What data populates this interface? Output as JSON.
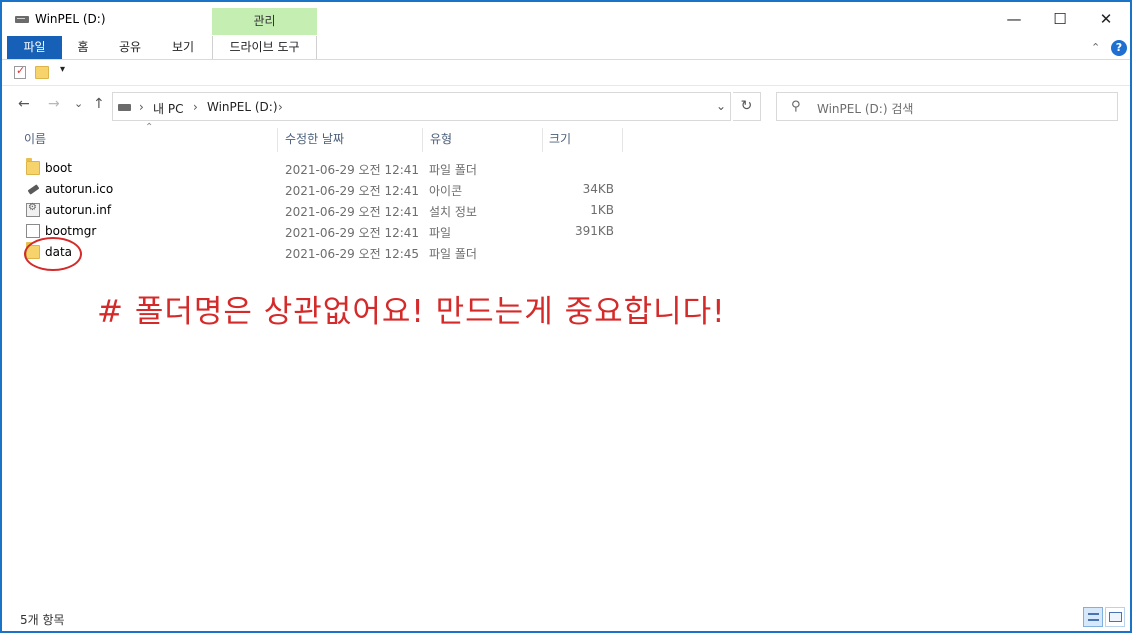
{
  "window": {
    "title": "WinPEL (D:)",
    "context_tab": "관리",
    "controls": {
      "minimize": "—",
      "maximize": "☐",
      "close": "✕"
    }
  },
  "ribbon": {
    "tabs": [
      "파일",
      "홈",
      "공유",
      "보기",
      "드라이브 도구"
    ],
    "collapse_icon": "chevron-up-icon",
    "help": "?"
  },
  "navigation": {
    "back": "←",
    "forward": "→",
    "recent": "⌄",
    "up": "↑",
    "breadcrumb": [
      "내 PC",
      "WinPEL (D:)"
    ],
    "separator": "›",
    "refresh": "↻",
    "search_placeholder": "WinPEL (D:) 검색"
  },
  "columns": {
    "name": "이름",
    "date": "수정한 날짜",
    "type": "유형",
    "size": "크기"
  },
  "files": [
    {
      "name": "boot",
      "date": "2021-06-29 오전 12:41",
      "type": "파일 폴더",
      "size": "",
      "icon": "folder-icon"
    },
    {
      "name": "autorun.ico",
      "date": "2021-06-29 오전 12:41",
      "type": "아이콘",
      "size": "34KB",
      "icon": "usb-icon"
    },
    {
      "name": "autorun.inf",
      "date": "2021-06-29 오전 12:41",
      "type": "설치 정보",
      "size": "1KB",
      "icon": "settings-file-icon"
    },
    {
      "name": "bootmgr",
      "date": "2021-06-29 오전 12:41",
      "type": "파일",
      "size": "391KB",
      "icon": "file-icon"
    },
    {
      "name": "data",
      "date": "2021-06-29 오전 12:45",
      "type": "파일 폴더",
      "size": "",
      "icon": "folder-icon"
    }
  ],
  "annotation": "# 폴더명은 상관없어요! 만드는게 중요합니다!",
  "status": {
    "item_count": "5개 항목"
  },
  "colors": {
    "accent": "#1660b8",
    "context_tab": "#c5eeb3",
    "annotation": "#d42a2a"
  }
}
